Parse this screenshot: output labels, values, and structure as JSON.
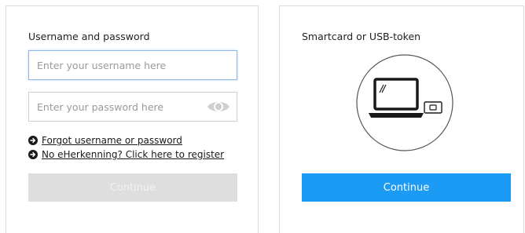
{
  "credentials_panel": {
    "title": "Username and password",
    "username": {
      "value": "",
      "placeholder": "Enter your username here"
    },
    "password": {
      "value": "",
      "placeholder": "Enter your password here"
    },
    "links": {
      "forgot": "Forgot username or password",
      "register": "No eHerkenning? Click here to register"
    },
    "continue_label": "Continue"
  },
  "token_panel": {
    "title": "Smartcard or USB-token",
    "continue_label": "Continue"
  },
  "icons": {
    "password_toggle": "eye-icon",
    "link_bullet": "arrow-circle-right-icon",
    "illustration": "laptop-with-smartcard-icon"
  },
  "colors": {
    "primary_button": "#1c9bf4",
    "disabled_button": "#dedede",
    "input_focus_border": "#8fb8e4",
    "panel_border": "#dcdcdc"
  }
}
